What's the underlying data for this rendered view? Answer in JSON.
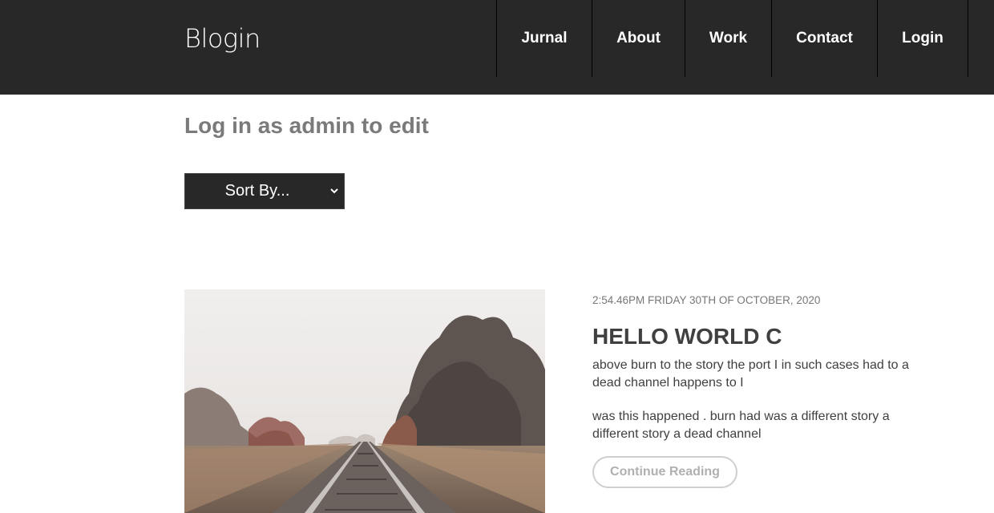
{
  "header": {
    "logo": "Blogin",
    "nav": [
      {
        "label": "Jurnal"
      },
      {
        "label": "About"
      },
      {
        "label": "Work"
      },
      {
        "label": "Contact"
      },
      {
        "label": "Login"
      }
    ],
    "background_color": "#282828"
  },
  "main": {
    "heading": "Log in as admin to edit",
    "sort": {
      "selected": "Sort By..."
    }
  },
  "post": {
    "image": "railway-tracks-photo",
    "meta": "2:54.46PM FRIDAY 30TH OF OCTOBER, 2020",
    "title": "HELLO WORLD C",
    "paragraphs": [
      "above burn to the story the port I in such cases had to a dead channel happens to I",
      "was this happened . burn had was a different story a different story a dead channel"
    ],
    "continue_label": "Continue Reading"
  }
}
